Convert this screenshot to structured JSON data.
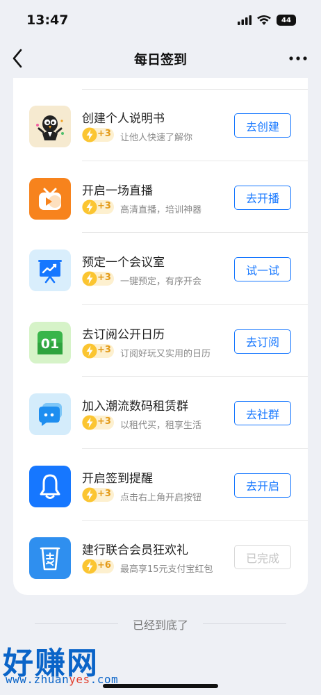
{
  "status_bar": {
    "time": "13:47",
    "battery": "44"
  },
  "nav": {
    "title": "每日签到"
  },
  "tasks": [
    {
      "title": "创建个人说明书",
      "reward": "+3",
      "desc": "让他人快速了解你",
      "button": "去创建",
      "icon": "profile-mascot-icon",
      "icon_bg": "#f6ead0"
    },
    {
      "title": "开启一场直播",
      "reward": "+3",
      "desc": "高清直播，培训神器",
      "button": "去开播",
      "icon": "live-tv-icon",
      "icon_bg": "#f7831d"
    },
    {
      "title": "预定一个会议室",
      "reward": "+3",
      "desc": "一键预定，有序开会",
      "button": "试一试",
      "icon": "presentation-board-icon",
      "icon_bg": "#d9eefc"
    },
    {
      "title": "去订阅公开日历",
      "reward": "+3",
      "desc": "订阅好玩又实用的日历",
      "button": "去订阅",
      "icon": "calendar-icon",
      "icon_bg": "#d6f3c8"
    },
    {
      "title": "加入潮流数码租赁群",
      "reward": "+3",
      "desc": "以租代买，租享生活",
      "button": "去社群",
      "icon": "chat-bubble-icon",
      "icon_bg": "#d4ecfb"
    },
    {
      "title": "开启签到提醒",
      "reward": "+3",
      "desc": "点击右上角开启按钮",
      "button": "去开启",
      "icon": "bell-icon",
      "icon_bg": "#1677ff"
    },
    {
      "title": "建行联合会员狂欢礼",
      "reward": "+6",
      "desc": "最高享15元支付宝红包",
      "button": "已完成",
      "icon": "alipay-cup-icon",
      "icon_bg": "#2f8fef",
      "done": true
    }
  ],
  "footer": {
    "end_text": "已经到底了"
  },
  "watermark": {
    "text": "好赚网",
    "url_prefix": "www.zhuan",
    "url_accent": "yes",
    "url_suffix": ".com"
  },
  "colors": {
    "accent": "#1677ff",
    "reward_bg": "#fdf0cf",
    "reward_text": "#e39a18"
  }
}
